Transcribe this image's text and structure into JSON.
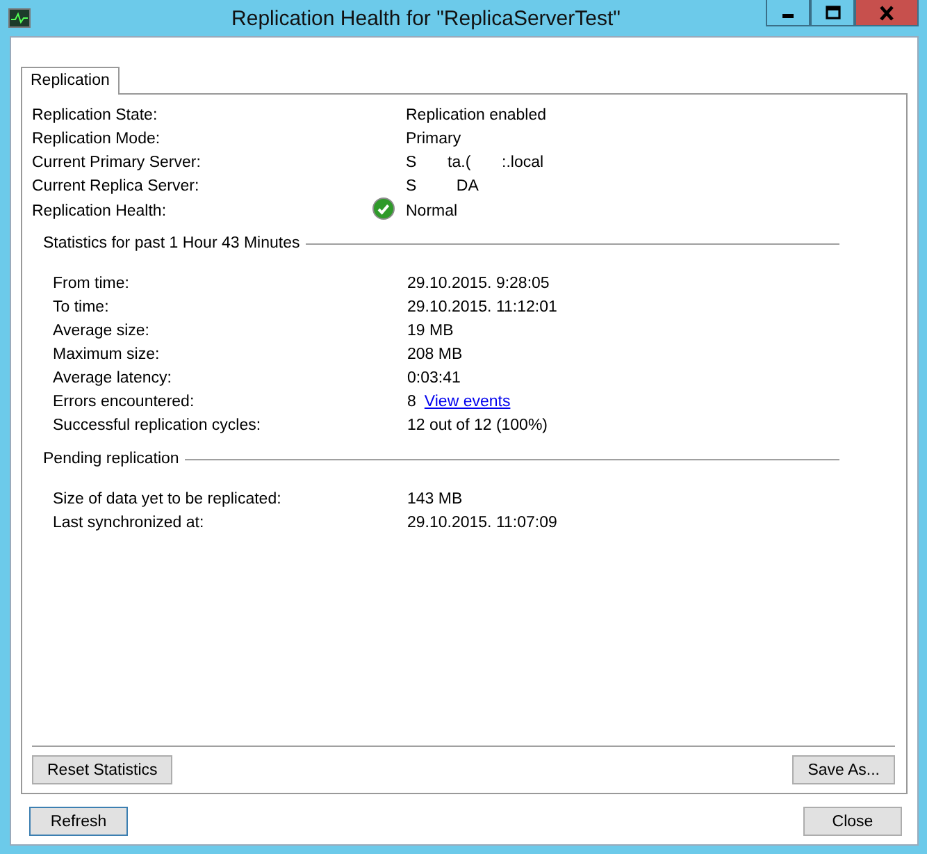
{
  "window": {
    "title": "Replication Health for \"ReplicaServerTest\""
  },
  "tabs": [
    {
      "label": "Replication",
      "selected": true
    }
  ],
  "summary": [
    {
      "kind": "text",
      "label": "Replication State:",
      "value": "Replication enabled"
    },
    {
      "kind": "text",
      "label": "Replication Mode:",
      "value": "Primary"
    },
    {
      "kind": "text",
      "label": "Current Primary Server:",
      "value": "S       ta.(       :.local"
    },
    {
      "kind": "text",
      "label": "Current Replica Server:",
      "value": "S         DA"
    },
    {
      "kind": "healthy",
      "label": "Replication Health:",
      "value": "Normal"
    }
  ],
  "groups": [
    {
      "title": "Statistics for past 1 Hour 43 Minutes",
      "rows": [
        {
          "label": "From time:",
          "value": "29.10.2015. 9:28:05"
        },
        {
          "label": "To time:",
          "value": "29.10.2015. 11:12:01"
        },
        {
          "label": "Average size:",
          "value": "19 MB"
        },
        {
          "label": "Maximum size:",
          "value": "208 MB"
        },
        {
          "label": "Average latency:",
          "value": "0:03:41"
        },
        {
          "label": "Errors encountered:",
          "value": "8",
          "link": "View events"
        },
        {
          "label": "Successful replication cycles:",
          "value": "12 out of 12 (100%)"
        }
      ]
    },
    {
      "title": "Pending replication",
      "rows": [
        {
          "label": "Size of data yet to be replicated:",
          "value": "143 MB"
        },
        {
          "label": "Last synchronized at:",
          "value": "29.10.2015. 11:07:09"
        }
      ]
    }
  ],
  "panel_buttons": [
    "Reset Statistics",
    "Save As..."
  ],
  "dialog_buttons": [
    "Refresh",
    "Close"
  ]
}
